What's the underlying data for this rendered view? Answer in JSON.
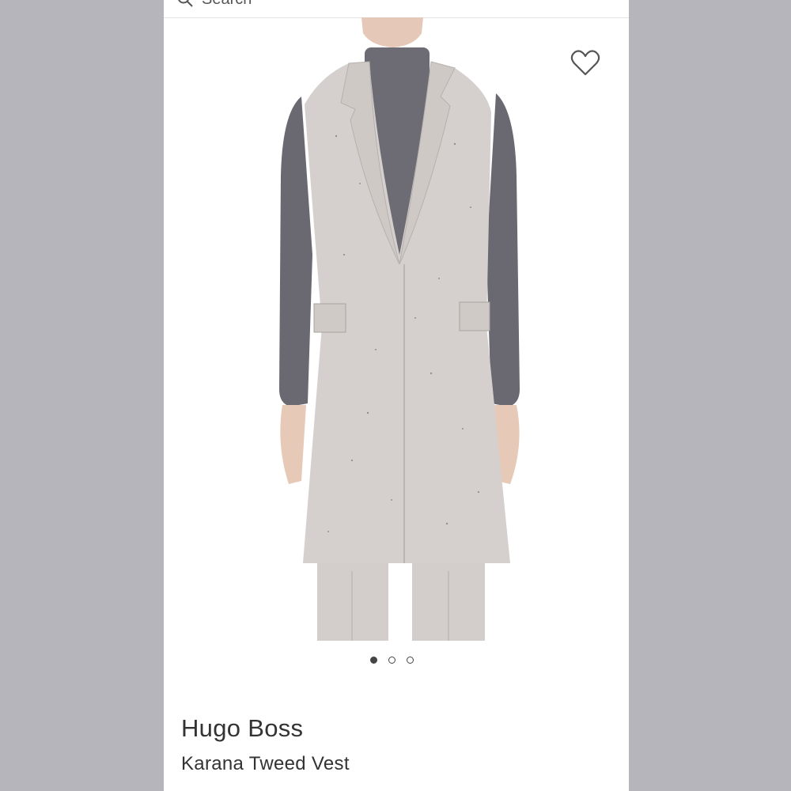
{
  "search": {
    "placeholder": "Search",
    "icon": "search-icon"
  },
  "product": {
    "brand": "Hugo Boss",
    "name": "Karana Tweed Vest",
    "favorite_icon": "heart-icon"
  },
  "gallery": {
    "count": 3,
    "active_index": 0
  },
  "colors": {
    "backdrop": "#b6b5bb",
    "vest": "#d5d0cd",
    "turtleneck": "#6b6a72",
    "text": "#333333"
  }
}
